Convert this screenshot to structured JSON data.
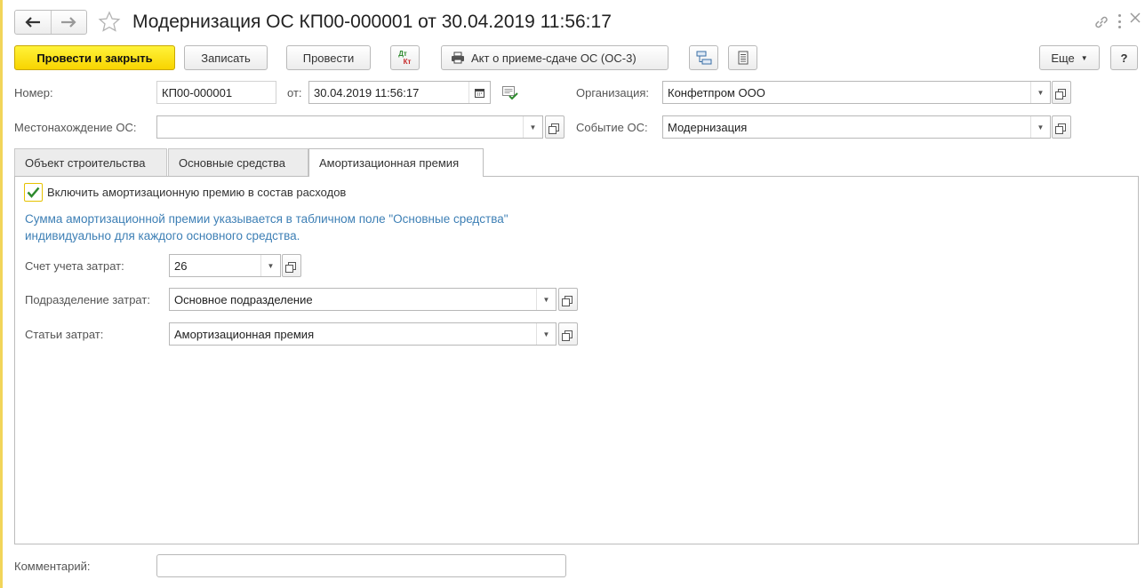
{
  "window": {
    "title": "Модернизация ОС КП00-000001 от 30.04.2019 11:56:17"
  },
  "toolbar": {
    "post_close": "Провести и закрыть",
    "save": "Записать",
    "post": "Провести",
    "dtkt_top": "Дт",
    "dtkt_bottom": "Кт",
    "print_act": "Акт о приеме-сдаче ОС (ОС-3)",
    "more": "Еще",
    "help": "?"
  },
  "header": {
    "number_label": "Номер:",
    "number_value": "КП00-000001",
    "date_label": "от:",
    "date_value": "30.04.2019 11:56:17",
    "org_label": "Организация:",
    "org_value": "Конфетпром ООО",
    "location_label": "Местонахождение ОС:",
    "location_value": "",
    "event_label": "Событие ОС:",
    "event_value": "Модернизация"
  },
  "tabs": [
    {
      "label": "Объект строительства"
    },
    {
      "label": "Основные средства"
    },
    {
      "label": "Амортизационная премия"
    }
  ],
  "premium": {
    "checkbox_label": "Включить амортизационную премию в состав расходов",
    "checked": true,
    "info_line1": "Сумма амортизационной премии указывается в табличном поле \"Основные средства\"",
    "info_line2": "индивидуально для каждого основного средства.",
    "account_label": "Счет учета затрат:",
    "account_value": "26",
    "department_label": "Подразделение затрат:",
    "department_value": "Основное подразделение",
    "cost_item_label": "Статьи затрат:",
    "cost_item_value": "Амортизационная премия"
  },
  "footer": {
    "comment_label": "Комментарий:",
    "comment_value": ""
  },
  "colors": {
    "primary_button": "#f8d400",
    "info_text": "#3d7fb5",
    "checkbox_border": "#e6c200",
    "checkmark": "#2e8a2e"
  }
}
